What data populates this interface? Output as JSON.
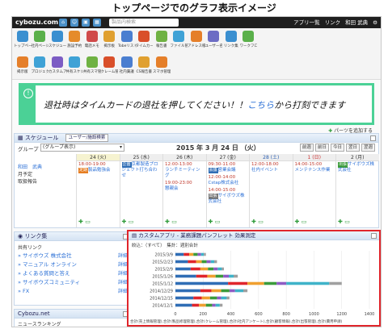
{
  "caption": "トップページでのグラフ表示イメージ",
  "header": {
    "logo": "cybozu.com",
    "search_placeholder": "製品内検索",
    "right_items": [
      "アプリ一覧",
      "リンク",
      "和田",
      "武典"
    ]
  },
  "apps": {
    "row1": [
      "トップページ",
      "社内ページ",
      "スケジュール",
      "施設予約",
      "電話メモ",
      "掲示板",
      "Tobeリスト",
      "タイムカード",
      "報告書",
      "ファイル管理",
      "アドレス帳",
      "ユーザー名簿",
      "リンク集",
      "ワークフロー"
    ],
    "row2": [
      "掲示版",
      "プロジェクト",
      "カスタムアプリ",
      "共有スケジュール",
      "共有スマ管理",
      "クレーム管理",
      "社内稟議",
      "CS報告書",
      "スマホ管理"
    ],
    "row2_colors": [
      "#e57f2a",
      "#3fa2d6",
      "#7c5cc4",
      "#3fa2d6",
      "#6fb243",
      "#d94f2a",
      "#4a7ed0",
      "#e0a030",
      "#e57f2a"
    ],
    "row1_colors": [
      "#3a8fd0",
      "#5ab04a",
      "#3a8fd0",
      "#e58b2a",
      "#d04a4a",
      "#e0a030",
      "#4a7ed0",
      "#d94f2a",
      "#6fb243",
      "#3fa2d6",
      "#e57f2a",
      "#6c6cc4",
      "#3a8fd0",
      "#5ab04a"
    ]
  },
  "notice": {
    "text_before": "退社時はタイムカードの退社を押してください！！",
    "link": "こちら",
    "text_after": "から打刻できます"
  },
  "addparts": "パーツを追加する",
  "schedule": {
    "title": "スケジュール",
    "user_search": "ユーザー/施設検索",
    "group_label": "グループ",
    "group_value": "(グループ表示)",
    "date": "2015 年 3 月 24 日 （火）",
    "nav": [
      "前週",
      "前日",
      "今日",
      "翌日",
      "翌週"
    ],
    "user_lines": [
      "和田　武典",
      "月予定",
      "取扱報告"
    ],
    "days": [
      {
        "label": "24 (火)",
        "cls": "today",
        "events": [
          {
            "time": "18:00-19:00",
            "tag": "定期",
            "tagcolor": "",
            "text": "製品勉強会"
          }
        ]
      },
      {
        "label": "25 (水)",
        "cls": "",
        "events": [
          {
            "time": "",
            "tag": "企画",
            "tagcolor": "blue",
            "text": "京都製造プロジェクト打ち合わせ"
          }
        ]
      },
      {
        "label": "26 (木)",
        "cls": "",
        "events": [
          {
            "time": "12:00-13:00",
            "tag": "",
            "tagcolor": "",
            "text": "ランチミーティング"
          },
          {
            "time": "19:00-23:00",
            "tag": "",
            "tagcolor": "",
            "text": "懇親会"
          }
        ]
      },
      {
        "label": "27 (金)",
        "cls": "",
        "events": [
          {
            "time": "09:30-11:00",
            "tag": "会議",
            "tagcolor": "blue",
            "text": "営業会議"
          },
          {
            "time": "12:00-14:00",
            "tag": "",
            "tagcolor": "",
            "text": "Cstap株式会社"
          },
          {
            "time": "14:00-15:00",
            "tag": "出張",
            "tagcolor": "gray",
            "text": "サイボウズ株式会社"
          }
        ]
      },
      {
        "label": "28 (土)",
        "cls": "sat",
        "events": [
          {
            "time": "12:00-18:00",
            "tag": "",
            "tagcolor": "",
            "text": "社内イベント"
          }
        ]
      },
      {
        "label": "1 (日)",
        "cls": "sun",
        "events": [
          {
            "time": "14:00-15:00",
            "tag": "",
            "tagcolor": "",
            "text": "メンテナンス作業"
          }
        ]
      },
      {
        "label": "2 (月)",
        "cls": "",
        "events": [
          {
            "time": "",
            "tag": "出張",
            "tagcolor": "green",
            "text": "サイボウズ株式会社"
          }
        ]
      }
    ]
  },
  "links": {
    "title": "リンク集",
    "subtitle": "共有リンク",
    "items": [
      {
        "name": "サイボウズ 株式会社",
        "detail": "詳細"
      },
      {
        "name": "マニュアル オンライン",
        "detail": "詳細"
      },
      {
        "name": "よくある質問と答え",
        "detail": "詳細"
      },
      {
        "name": "サイボウズコミュニティ",
        "detail": "詳細"
      },
      {
        "name": "FX",
        "detail": "詳細"
      }
    ]
  },
  "cybozu_net": {
    "title": "Cybozu.net",
    "item": "ニュースランキング"
  },
  "custom_app": {
    "title": "カスタムアプリ - 業務課題パンフレット 効果測定",
    "filter": "絞込：（すべて）　集計：週別合計",
    "footer": "合計(売上情報管理),合計(製品修理管理),合計(クレーム管理),合計(社内アンケート),合計(顧客情報),合計(出張管理),合計(費用申請)"
  },
  "chart_data": {
    "type": "bar",
    "orientation": "horizontal",
    "stacked": true,
    "categories": [
      "2015/3/9",
      "2015/2/23",
      "2015/2/9",
      "2015/1/26",
      "2015/1/12",
      "2014/12/29",
      "2014/12/15",
      "2014/12/1"
    ],
    "xlim": [
      0,
      1400
    ],
    "xticks": [
      0,
      200,
      400,
      600,
      800,
      1000,
      1200,
      1400
    ],
    "series": [
      {
        "name": "合計(売上情報管理)",
        "color": "#2f6db5",
        "values": [
          60,
          90,
          110,
          150,
          380,
          180,
          130,
          120
        ]
      },
      {
        "name": "合計(製品修理管理)",
        "color": "#e0252b",
        "values": [
          40,
          60,
          70,
          80,
          140,
          80,
          60,
          50
        ]
      },
      {
        "name": "合計(クレーム管理)",
        "color": "#f0a030",
        "values": [
          30,
          40,
          55,
          60,
          120,
          70,
          60,
          50
        ]
      },
      {
        "name": "合計(社内アンケート)",
        "color": "#3b9b3b",
        "values": [
          30,
          35,
          40,
          55,
          90,
          60,
          50,
          45
        ]
      },
      {
        "name": "合計(顧客情報)",
        "color": "#8e5cc4",
        "values": [
          25,
          30,
          30,
          40,
          70,
          40,
          30,
          25
        ]
      },
      {
        "name": "合計(出張管理)",
        "color": "#3fb3c9",
        "values": [
          20,
          25,
          30,
          35,
          310,
          60,
          40,
          30
        ]
      },
      {
        "name": "合計(費用申請)",
        "color": "#a0a0a0",
        "values": [
          15,
          20,
          15,
          30,
          90,
          30,
          20,
          20
        ]
      }
    ]
  }
}
